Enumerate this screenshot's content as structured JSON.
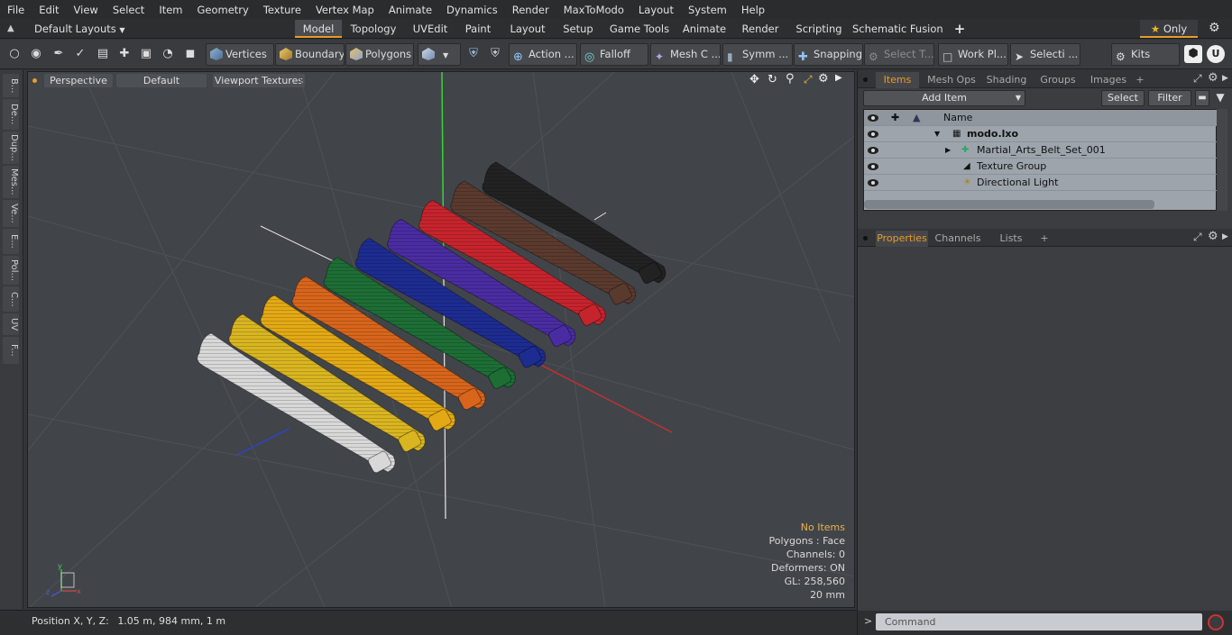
{
  "menu": [
    "File",
    "Edit",
    "View",
    "Select",
    "Item",
    "Geometry",
    "Texture",
    "Vertex Map",
    "Animate",
    "Dynamics",
    "Render",
    "MaxToModo",
    "Layout",
    "System",
    "Help"
  ],
  "layout_bar": {
    "layout_dropdown": "Default Layouts",
    "tabs": [
      "Model",
      "Topology",
      "UVEdit",
      "Paint",
      "Layout",
      "Setup",
      "Game Tools",
      "Animate",
      "Render",
      "Scripting",
      "Schematic Fusion"
    ],
    "active_tab": "Model",
    "add_tab": "+",
    "only_label": "Only"
  },
  "toolbar": {
    "vertices": "Vertices",
    "boundary": "Boundary",
    "polygons": "Polygons",
    "action": "Action",
    "falloff": "Falloff",
    "mesh": "Mesh C ...",
    "symm": "Symm ...",
    "snapping": "Snapping",
    "select_t": "Select T...",
    "work_pl": "Work Pl...",
    "selecti": "Selecti ...",
    "kits": "Kits"
  },
  "left_strip": [
    "B...",
    "De...",
    "Dup...",
    "Mes...",
    "Ve...",
    "E...",
    "Pol...",
    "C...",
    "UV",
    "F..."
  ],
  "viewport": {
    "view_mode": "Perspective",
    "shading": "Default",
    "textures": "Viewport Textures",
    "info": {
      "no_items": "No Items",
      "polygons": "Polygons : Face",
      "channels": "Channels: 0",
      "deformers": "Deformers: ON",
      "gl": "GL: 258,560",
      "scale": "20 mm"
    },
    "belt_colors": [
      "#d8d8d8",
      "#d9b521",
      "#e3a915",
      "#d8651b",
      "#1d6e35",
      "#1d2c91",
      "#4a2ca2",
      "#c6242d",
      "#5b3a2e",
      "#222222"
    ]
  },
  "status": {
    "position_label": "Position X, Y, Z:",
    "position_value": "1.05 m, 984 mm, 1 m"
  },
  "items_panel": {
    "tabs": [
      "Items",
      "Mesh Ops",
      "Shading",
      "Groups",
      "Images"
    ],
    "active_tab": "Items",
    "add_item": "Add Item",
    "select_btn": "Select",
    "filter_btn": "Filter",
    "column_name": "Name",
    "tree": [
      {
        "label": "modo.lxo",
        "bold": true
      },
      {
        "label": "Martial_Arts_Belt_Set_001"
      },
      {
        "label": "Texture Group"
      },
      {
        "label": "Directional Light"
      }
    ]
  },
  "props_panel": {
    "tabs": [
      "Properties",
      "Channels",
      "Lists"
    ],
    "active_tab": "Properties"
  },
  "command": {
    "prompt": ">",
    "placeholder": "Command"
  }
}
